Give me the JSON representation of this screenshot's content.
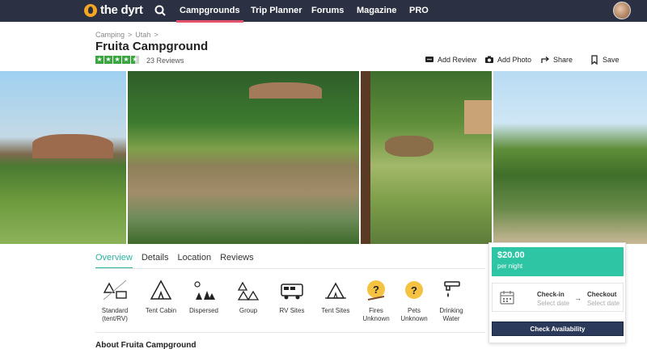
{
  "nav": {
    "logo_text": "the dyrt",
    "items": [
      {
        "label": "Campgrounds",
        "active": true
      },
      {
        "label": "Trip Planner",
        "active": false
      },
      {
        "label": "Forums",
        "active": false
      },
      {
        "label": "Magazine",
        "active": false
      },
      {
        "label": "PRO",
        "active": false
      }
    ]
  },
  "breadcrumb": [
    "Camping",
    ">",
    "Utah",
    ">"
  ],
  "campground": {
    "title": "Fruita Campground",
    "rating_stars": 4.5,
    "reviews_label": "23 Reviews"
  },
  "actions": {
    "add_review": "Add Review",
    "add_photo": "Add Photo",
    "share": "Share",
    "save": "Save"
  },
  "tabs": [
    "Overview",
    "Details",
    "Location",
    "Reviews"
  ],
  "amenities": [
    {
      "label": "Standard (tent/RV)",
      "icon": "tent-rv-icon"
    },
    {
      "label": "Tent Cabin",
      "icon": "tent-cabin-icon"
    },
    {
      "label": "Dispersed",
      "icon": "dispersed-icon"
    },
    {
      "label": "Group",
      "icon": "group-icon"
    },
    {
      "label": "RV Sites",
      "icon": "rv-icon"
    },
    {
      "label": "Tent Sites",
      "icon": "tent-sites-icon"
    },
    {
      "label": "Fires Unknown",
      "icon": "fire-unknown-icon"
    },
    {
      "label": "Pets Unknown",
      "icon": "pet-unknown-icon"
    },
    {
      "label": "Drinking Water",
      "icon": "faucet-icon"
    }
  ],
  "about_heading": "About Fruita Campground",
  "booking": {
    "price": "$20.00",
    "price_unit": "per night",
    "checkin_label": "Check-in",
    "checkin_placeholder": "Select date",
    "checkout_label": "Checkout",
    "checkout_placeholder": "Select date",
    "button": "Check Availability"
  },
  "colors": {
    "nav_bg": "#2b3142",
    "accent_pink": "#e6516b",
    "teal": "#2bb3a0",
    "price_green": "#2dc5a4",
    "star_green": "#3aa63f",
    "button_navy": "#2b3a5a"
  }
}
